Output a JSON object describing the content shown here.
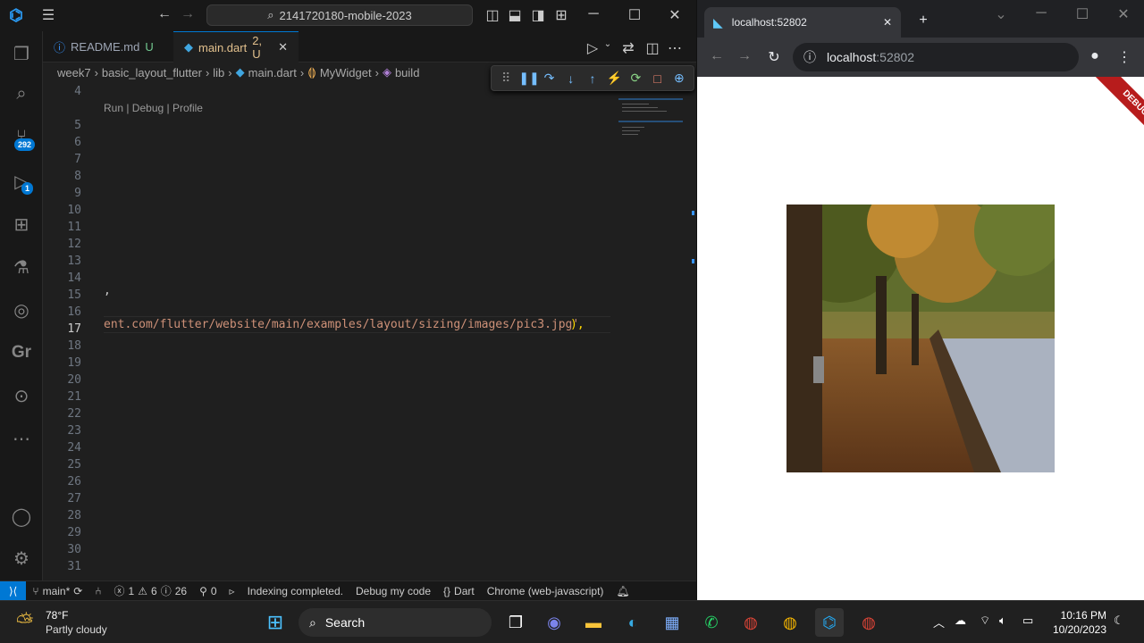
{
  "vscode": {
    "command_center": "2141720180-mobile-2023",
    "tabs": [
      {
        "label": "README.md",
        "status": "U"
      },
      {
        "label": "main.dart",
        "status": "2, U"
      }
    ],
    "breadcrumb": [
      "week7",
      "basic_layout_flutter",
      "lib",
      "main.dart",
      "MyWidget",
      "build"
    ],
    "codelens": "Run | Debug | Profile",
    "line_numbers": [
      "4",
      "5",
      "6",
      "7",
      "8",
      "9",
      "10",
      "11",
      "12",
      "13",
      "14",
      "15",
      "16",
      "17",
      "18",
      "19",
      "20",
      "21",
      "22",
      "23",
      "24",
      "25",
      "26",
      "27",
      "28",
      "29",
      "30",
      "31"
    ],
    "current_line": "17",
    "code_line_15": ",",
    "code_line_17_string": "ent.com/flutter/website/main/examples/layout/sizing/images/pic3.jpg'",
    "code_line_17_tail": "),",
    "activity_badges": {
      "source_control": "292",
      "run_debug": "1"
    },
    "activity_gr": "Gr",
    "status": {
      "branch": "main*",
      "errors": "1",
      "warnings": "6",
      "info": "26",
      "ports": "0",
      "indexing": "Indexing completed.",
      "debug_my_code": "Debug my code",
      "language": "Dart",
      "device": "Chrome (web-javascript)"
    }
  },
  "chrome": {
    "tab_title": "localhost:52802",
    "url_host": "localhost",
    "url_port": ":52802",
    "debug_banner": "DEBUG"
  },
  "taskbar": {
    "weather_temp": "78°F",
    "weather_desc": "Partly cloudy",
    "search_label": "Search",
    "time": "10:16 PM",
    "date": "10/20/2023"
  },
  "colors": {
    "accent": "#0078d4",
    "string": "#ce9178",
    "debug_ribbon": "#b71c1c"
  }
}
